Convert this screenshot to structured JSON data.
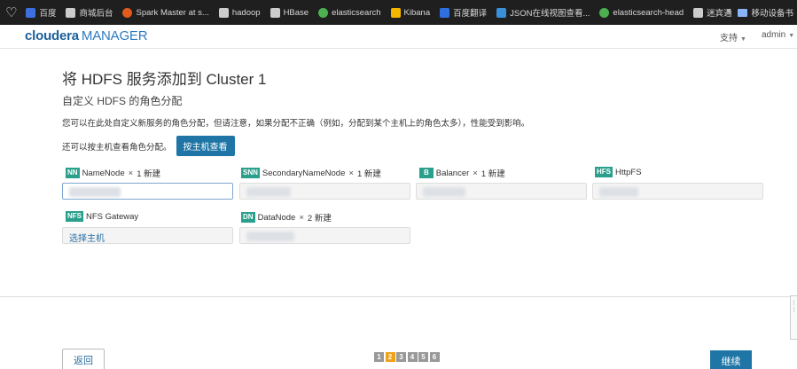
{
  "bookmarks": [
    {
      "label": "百度",
      "icon": "baidu-icon",
      "color": "#3d6fe0"
    },
    {
      "label": "商城后台",
      "icon": "page-icon",
      "color": "#cccccc"
    },
    {
      "label": "Spark Master at s...",
      "icon": "spark-icon",
      "color": "#e25a1c"
    },
    {
      "label": "hadoop",
      "icon": "page-icon",
      "color": "#cccccc"
    },
    {
      "label": "HBase",
      "icon": "page-icon",
      "color": "#cccccc"
    },
    {
      "label": "elasticsearch",
      "icon": "elastic-icon",
      "color": "#4caf50"
    },
    {
      "label": "Kibana",
      "icon": "kibana-icon",
      "color": "#f5b600"
    },
    {
      "label": "百度翻译",
      "icon": "translate-icon",
      "color": "#2f6fe0"
    },
    {
      "label": "JSON在线视图查看...",
      "icon": "json-icon",
      "color": "#3a8fd9"
    },
    {
      "label": "elasticsearch-head",
      "icon": "elastic-icon",
      "color": "#4caf50"
    },
    {
      "label": "迷宾通",
      "icon": "page-icon",
      "color": "#cccccc"
    }
  ],
  "bookmarks_more": "»",
  "mobile_bookmarks": "移动设备书",
  "header": {
    "logo_main": "cloudera",
    "logo_sub": "MANAGER",
    "support": "支持",
    "admin": "admin"
  },
  "page": {
    "title": "将 HDFS 服务添加到 Cluster 1",
    "subtitle": "自定义 HDFS 的角色分配",
    "description": "您可以在此处自定义新服务的角色分配，但请注意，如果分配不正确（例如，分配到某个主机上的角色太多），性能受到影响。",
    "host_hint": "还可以按主机查看角色分配。",
    "host_button": "按主机查看"
  },
  "roles": [
    {
      "badge": "NN",
      "name": "NameNode",
      "count": "1 新建",
      "value": ""
    },
    {
      "badge": "SNN",
      "name": "SecondaryNameNode",
      "count": "1 新建",
      "value": ""
    },
    {
      "badge": "B",
      "name": "Balancer",
      "count": "1 新建",
      "value": ""
    },
    {
      "badge": "HFS",
      "name": "HttpFS",
      "count": "",
      "value": ""
    },
    {
      "badge": "NFS",
      "name": "NFS Gateway",
      "count": "",
      "value": "选择主机"
    },
    {
      "badge": "DN",
      "name": "DataNode",
      "count": "2 新建",
      "value": ""
    }
  ],
  "times": "×",
  "footer": {
    "back": "返回",
    "next": "继续",
    "pages": [
      "1",
      "2",
      "3",
      "4",
      "5",
      "6"
    ],
    "current_page": "2"
  },
  "colors": {
    "primary": "#1f76a6",
    "badge": "#2aa08c",
    "pager_current": "#f0a118"
  }
}
